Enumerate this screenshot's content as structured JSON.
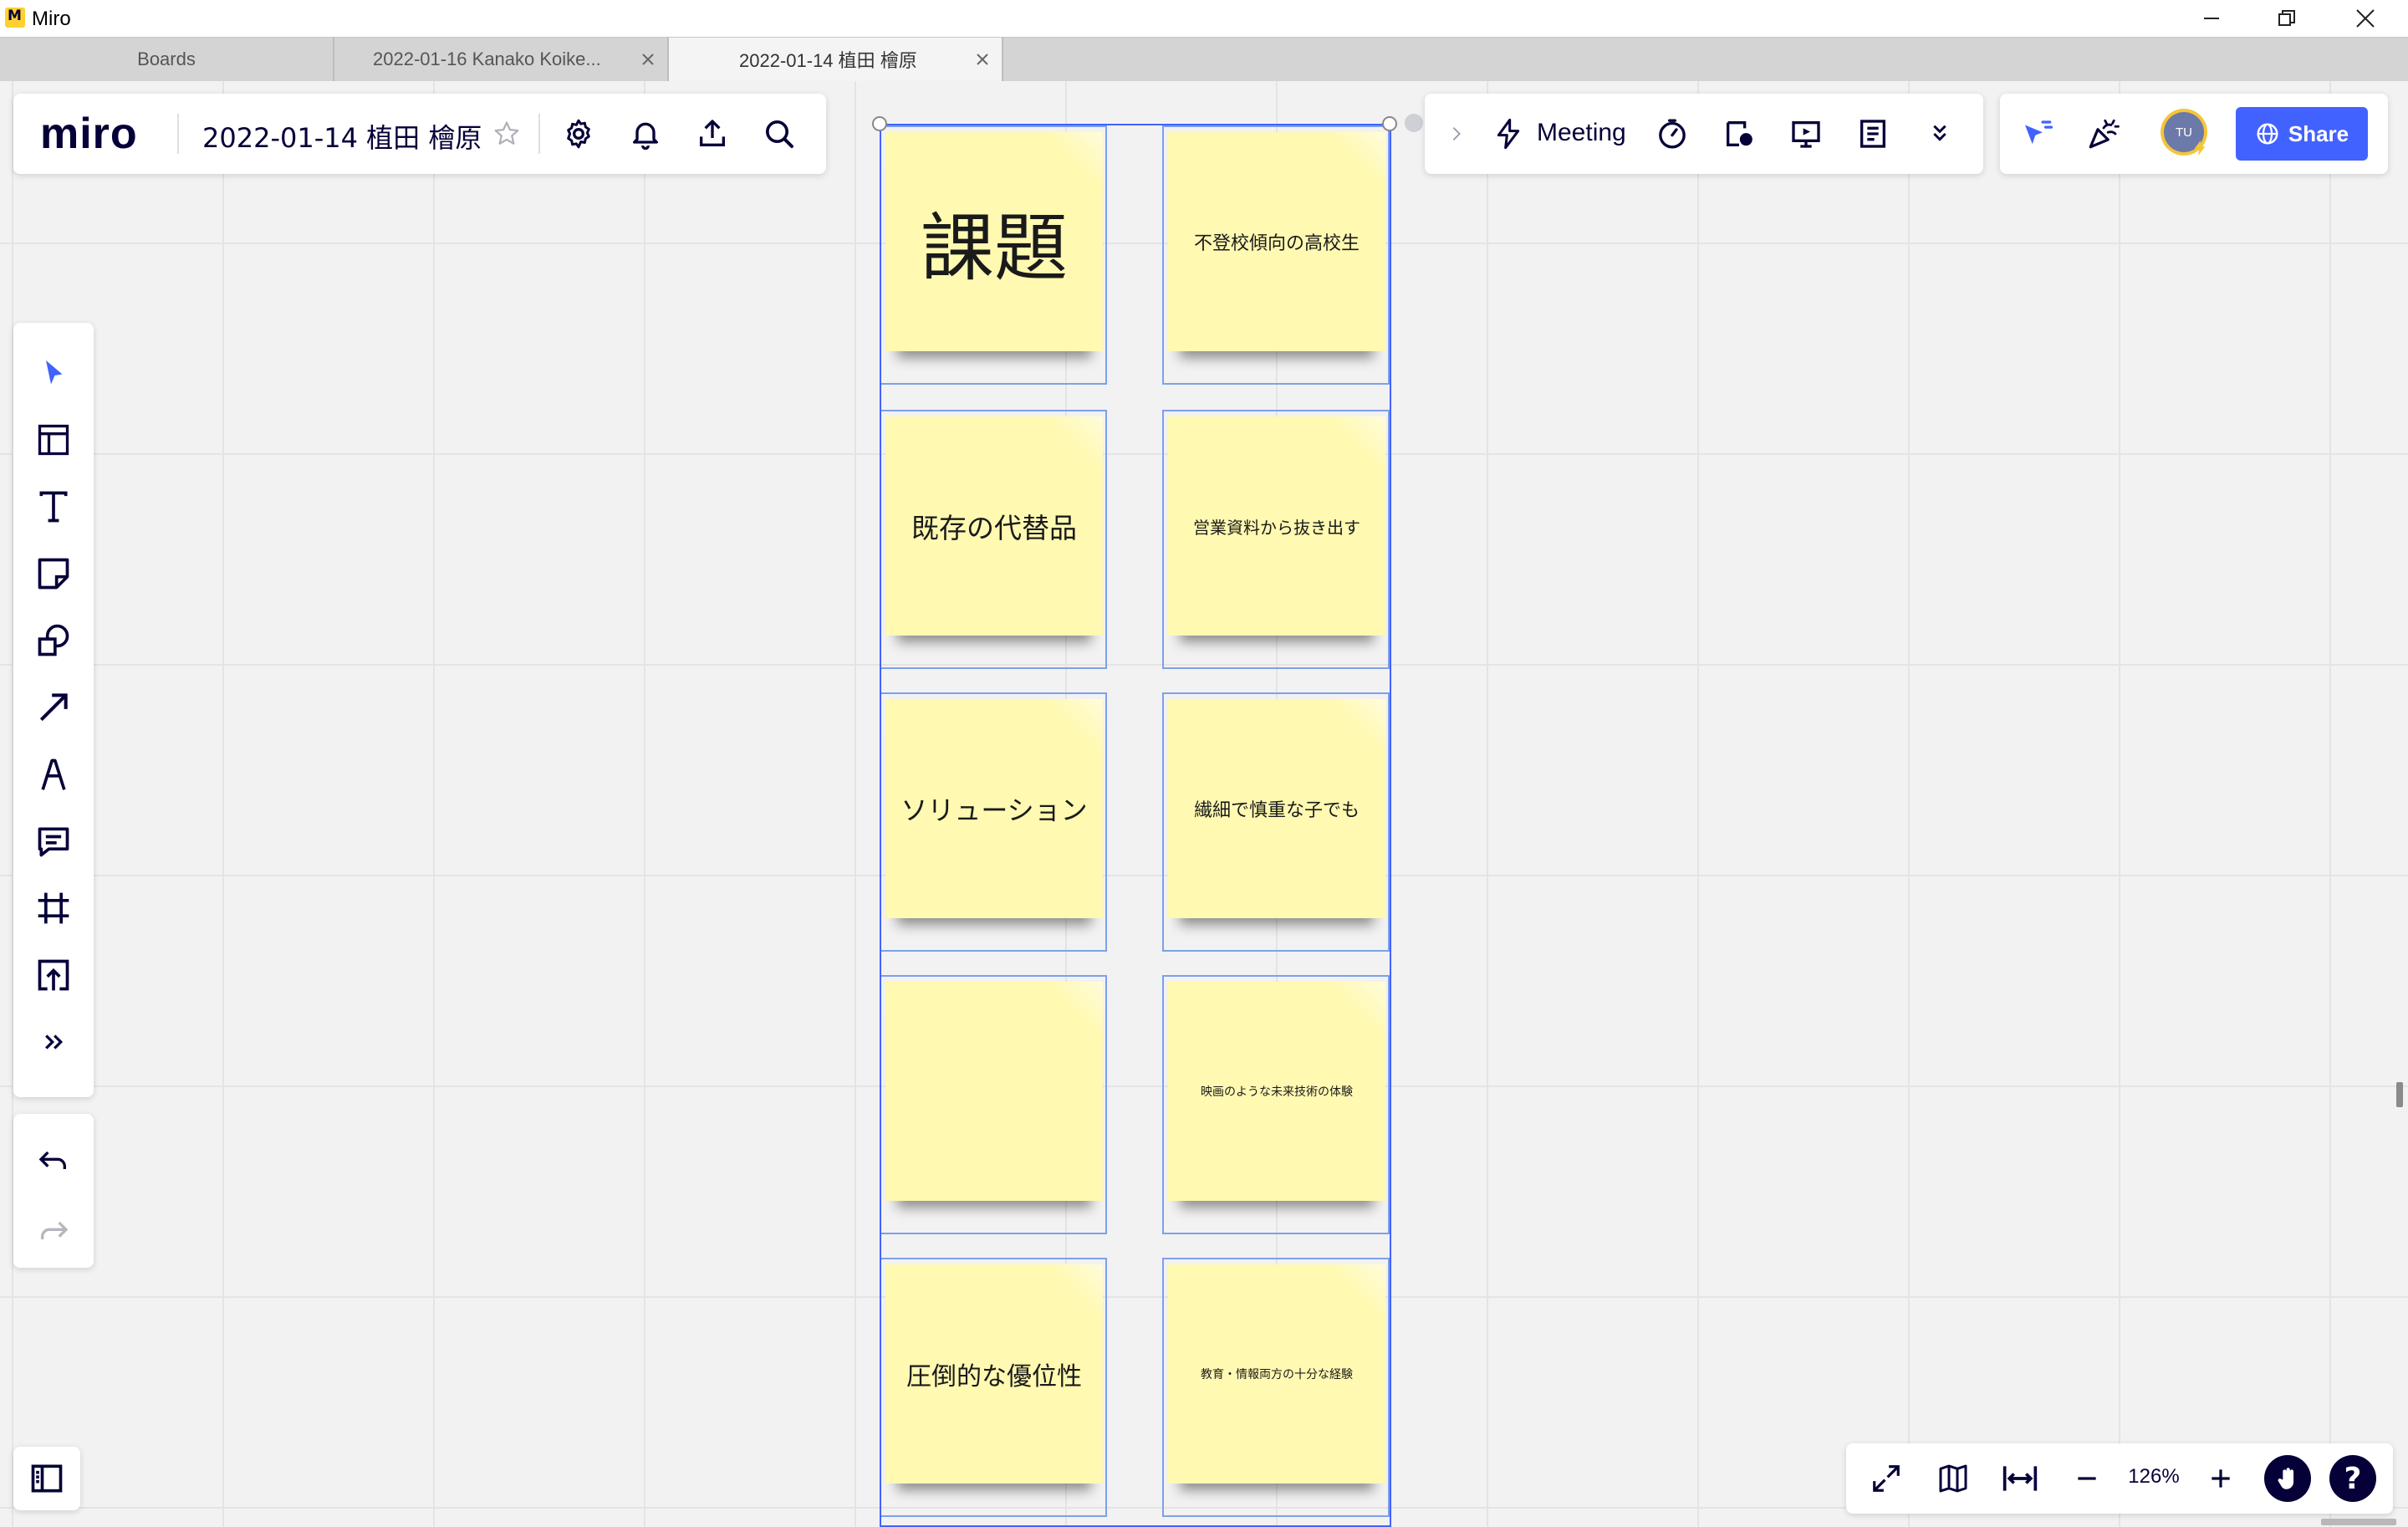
{
  "window": {
    "app_title": "Miro",
    "logo_letter": "M",
    "controls": [
      "minimize-icon",
      "restore-icon",
      "close-icon"
    ]
  },
  "tabs": [
    {
      "label": "Boards",
      "active": false
    },
    {
      "label": "2022-01-16 Kanako Koike...",
      "active": false
    },
    {
      "label": "2022-01-14 植田 檜原",
      "active": true
    }
  ],
  "header": {
    "logo": "miro",
    "board_title": "2022-01-14 植田 檜原",
    "icons": [
      "star-icon",
      "settings-icon",
      "bell-icon",
      "upload-icon",
      "search-icon"
    ]
  },
  "collab_bar": {
    "meeting_label": "Meeting",
    "icons": [
      "chevron-right-icon",
      "lightning-icon",
      "timer-icon",
      "voting-icon",
      "presentation-icon",
      "notes-icon",
      "chevron-double-down-icon"
    ]
  },
  "user_bar": {
    "avatar_initials": "TU",
    "share_label": "Share",
    "colors": {
      "share_bg": "#4262ff",
      "avatar_ring": "#f5c53a",
      "accent": "#4262ff"
    }
  },
  "toolbar": {
    "tools": [
      "cursor-icon",
      "templates-icon",
      "text-icon",
      "sticky-note-icon",
      "shapes-icon",
      "arrow-icon",
      "pen-icon",
      "comment-icon",
      "frame-icon",
      "upload-icon",
      "more-tools-icon"
    ],
    "history": [
      "undo-icon",
      "redo-icon"
    ]
  },
  "board": {
    "stickies": [
      {
        "text": "課題"
      },
      {
        "text": "不登校傾向の高校生"
      },
      {
        "text": "既存の代替品"
      },
      {
        "text": "営業資料から抜き出す"
      },
      {
        "text": "ソリューション"
      },
      {
        "text": "繊細で慎重な子でも"
      },
      {
        "text": ""
      },
      {
        "text": "映画のような未来技術の体験"
      },
      {
        "text": "圧倒的な優位性"
      },
      {
        "text": "教育・情報両方の十分な経験"
      }
    ],
    "sticky_color": "#fff9b1"
  },
  "zoom": {
    "level": "126%",
    "icons": [
      "fit-screen-icon",
      "map-icon",
      "fit-width-icon",
      "zoom-out-icon",
      "zoom-in-icon",
      "hand-icon",
      "help-icon"
    ]
  },
  "sidebar_toggle_icon": "board-panel-icon"
}
